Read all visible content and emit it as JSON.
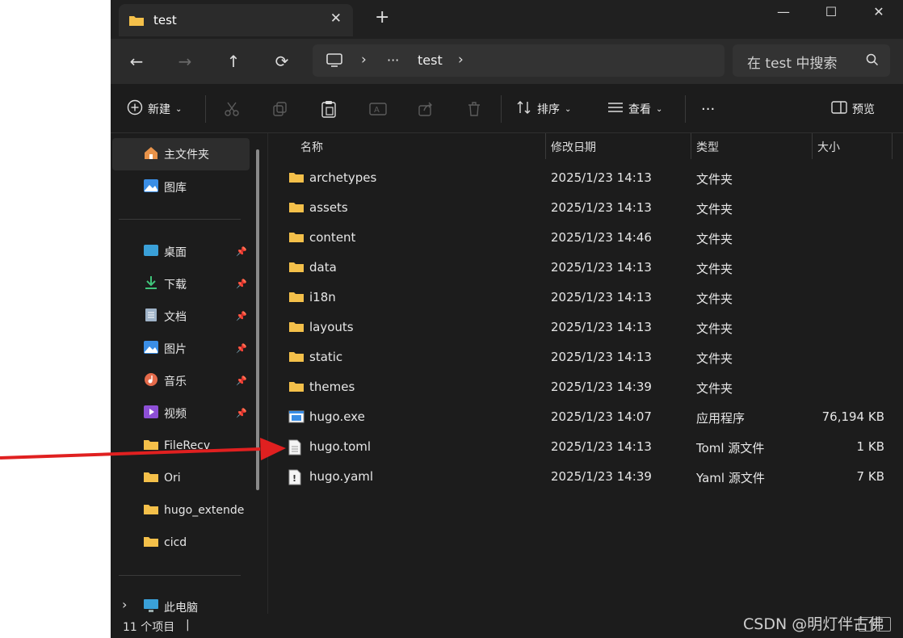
{
  "window": {
    "tab_title": "test",
    "close_tab": "✕",
    "new_tab": "+"
  },
  "controls": {
    "minimize": "—",
    "maximize": "☐",
    "close": "✕"
  },
  "nav": {
    "back": "←",
    "forward": "→",
    "up": "↑",
    "refresh": "⟳"
  },
  "address": {
    "separator": "›",
    "more": "···",
    "crumb": "test"
  },
  "search": {
    "placeholder": "在 test 中搜索"
  },
  "toolbar": {
    "new_label": "新建",
    "sort_label": "排序",
    "view_label": "查看",
    "more_label": "···",
    "preview_label": "预览"
  },
  "sidebar": {
    "home": "主文件夹",
    "gallery": "图库",
    "pinned": [
      {
        "label": "桌面",
        "icon": "desktop-icon"
      },
      {
        "label": "下载",
        "icon": "download-icon"
      },
      {
        "label": "文档",
        "icon": "documents-icon"
      },
      {
        "label": "图片",
        "icon": "pictures-icon"
      },
      {
        "label": "音乐",
        "icon": "music-icon"
      },
      {
        "label": "视频",
        "icon": "video-icon"
      }
    ],
    "folders": [
      "FileRecv",
      "Ori",
      "hugo_extende",
      "cicd"
    ],
    "this_pc": "此电脑",
    "expand": "›"
  },
  "columns": {
    "name": "名称",
    "modified": "修改日期",
    "type": "类型",
    "size": "大小"
  },
  "files": [
    {
      "name": "archetypes",
      "date": "2025/1/23 14:13",
      "type": "文件夹",
      "size": "",
      "kind": "folder"
    },
    {
      "name": "assets",
      "date": "2025/1/23 14:13",
      "type": "文件夹",
      "size": "",
      "kind": "folder"
    },
    {
      "name": "content",
      "date": "2025/1/23 14:46",
      "type": "文件夹",
      "size": "",
      "kind": "folder"
    },
    {
      "name": "data",
      "date": "2025/1/23 14:13",
      "type": "文件夹",
      "size": "",
      "kind": "folder"
    },
    {
      "name": "i18n",
      "date": "2025/1/23 14:13",
      "type": "文件夹",
      "size": "",
      "kind": "folder"
    },
    {
      "name": "layouts",
      "date": "2025/1/23 14:13",
      "type": "文件夹",
      "size": "",
      "kind": "folder"
    },
    {
      "name": "static",
      "date": "2025/1/23 14:13",
      "type": "文件夹",
      "size": "",
      "kind": "folder"
    },
    {
      "name": "themes",
      "date": "2025/1/23 14:39",
      "type": "文件夹",
      "size": "",
      "kind": "folder"
    },
    {
      "name": "hugo.exe",
      "date": "2025/1/23 14:07",
      "type": "应用程序",
      "size": "76,194 KB",
      "kind": "exe"
    },
    {
      "name": "hugo.toml",
      "date": "2025/1/23 14:13",
      "type": "Toml 源文件",
      "size": "1 KB",
      "kind": "doc"
    },
    {
      "name": "hugo.yaml",
      "date": "2025/1/23 14:39",
      "type": "Yaml 源文件",
      "size": "7 KB",
      "kind": "yaml"
    }
  ],
  "status": {
    "count": "11 个项目",
    "cursor": "|"
  },
  "watermark": "CSDN @明灯伴古佛",
  "colors": {
    "folder": "#f4c04a",
    "arrow": "#e02020",
    "background": "#1c1c1c"
  }
}
